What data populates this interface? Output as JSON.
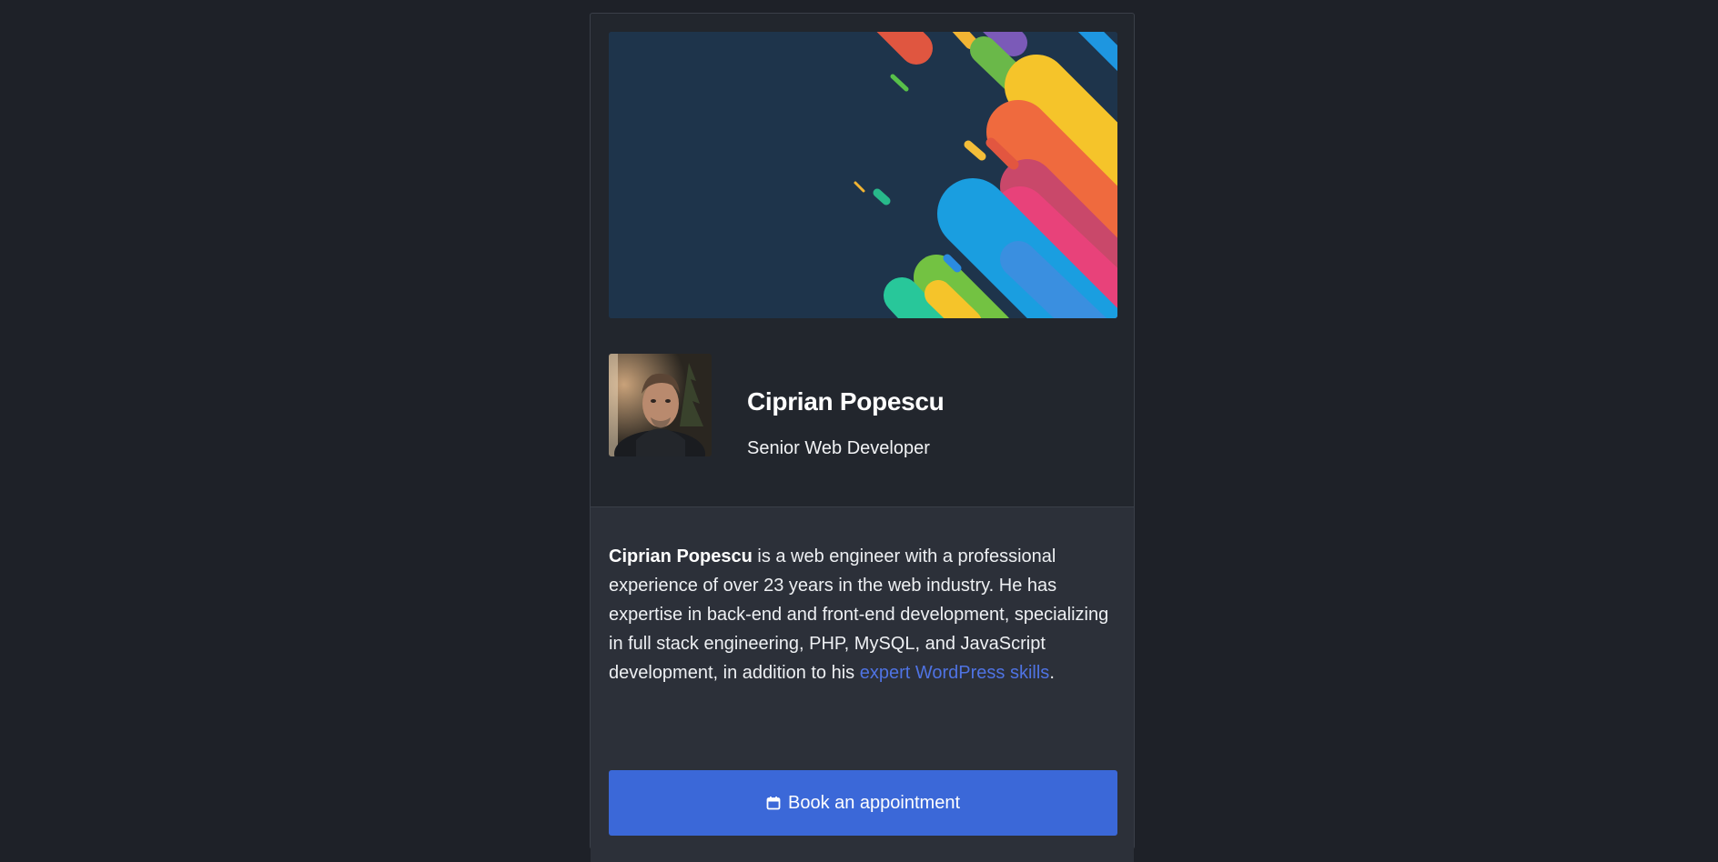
{
  "profile": {
    "name": "Ciprian Popescu",
    "role": "Senior Web Developer",
    "avatar_icon": "person-photo"
  },
  "bio": {
    "name_bold": "Ciprian Popescu",
    "text_part1": " is a web engineer with a professional experience of over 23 years in the web industry. He has expertise in back-end and front-end development, specializing in full stack engineering, PHP, MySQL, and JavaScript development, in addition to his ",
    "link_text": "expert WordPress skills",
    "text_part2": "."
  },
  "cta": {
    "label": "Book an appointment",
    "icon": "calendar-icon"
  },
  "colors": {
    "page_bg": "#1e2128",
    "card_bg": "#22262d",
    "about_bg": "#2c3039",
    "accent": "#3b68d8",
    "link": "#4f73e3",
    "banner_bg": "#1e344b"
  }
}
